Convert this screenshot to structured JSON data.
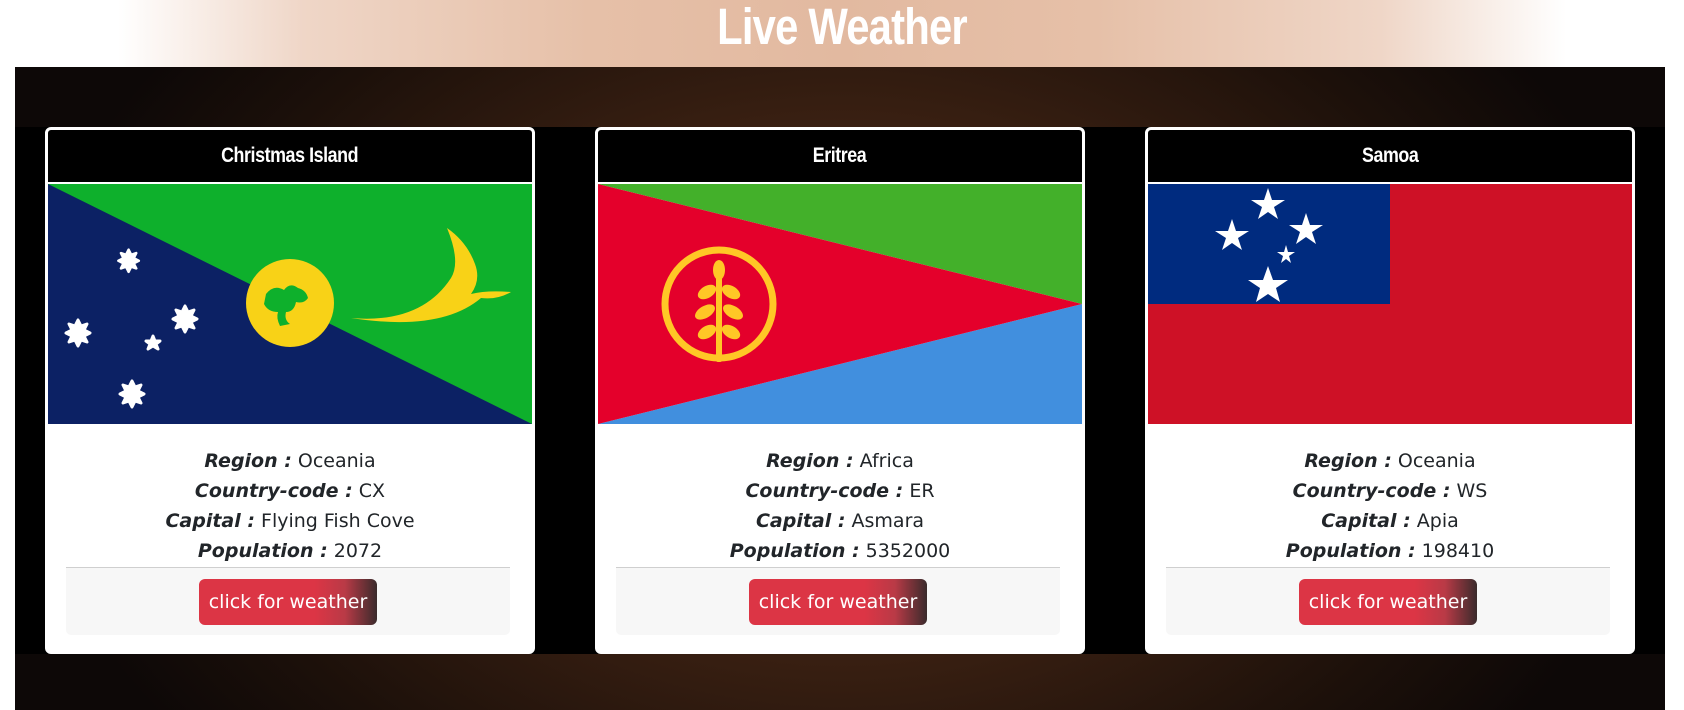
{
  "page": {
    "title": "Live Weather"
  },
  "labels": {
    "region": "Region :",
    "country_code": "Country-code :",
    "capital": "Capital :",
    "population": "Population :"
  },
  "cards": [
    {
      "name": "Christmas Island",
      "region": "Oceania",
      "country_code": "CX",
      "capital": "Flying Fish Cove",
      "population": "2072",
      "button_label": "click for weather"
    },
    {
      "name": "Eritrea",
      "region": "Africa",
      "country_code": "ER",
      "capital": "Asmara",
      "population": "5352000",
      "button_label": "click for weather"
    },
    {
      "name": "Samoa",
      "region": "Oceania",
      "country_code": "WS",
      "capital": "Apia",
      "population": "198410",
      "button_label": "click for weather"
    }
  ],
  "colors": {
    "button": "#dc3545",
    "card_header": "#000000",
    "title_text": "#ffffff"
  }
}
